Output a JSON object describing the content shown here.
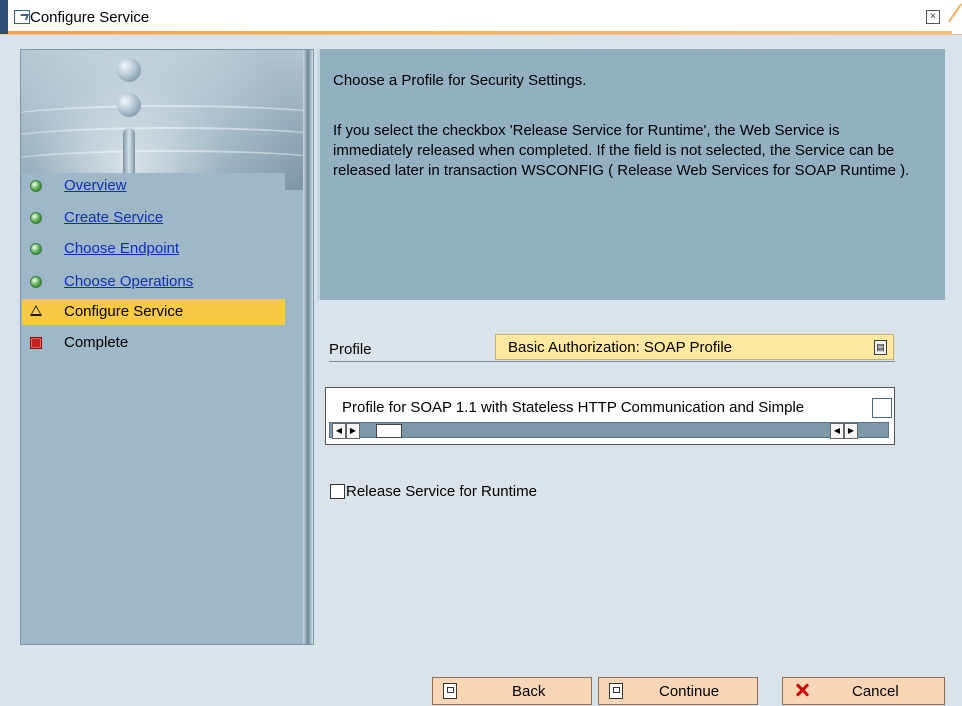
{
  "window": {
    "title": "Configure Service"
  },
  "nav": {
    "items": [
      {
        "label": "Overview"
      },
      {
        "label": "Create Service"
      },
      {
        "label": "Choose Endpoint"
      },
      {
        "label": "Choose Operations"
      },
      {
        "label": "Configure Service"
      },
      {
        "label": "Complete"
      }
    ]
  },
  "info": {
    "heading": "Choose a Profile for Security Settings.",
    "paragraph": "If you select the checkbox 'Release Service for Runtime', the Web Service is immediately released when completed. If the field is not selected, the Service can be released later in transaction WSCONFIG ( Release Web Services for SOAP Runtime )."
  },
  "profile": {
    "label": "Profile",
    "selected": "Basic Authorization: SOAP Profile",
    "description": "Profile for SOAP 1.1 with Stateless HTTP Communication and Simple"
  },
  "release": {
    "label": "Release Service for Runtime"
  },
  "buttons": {
    "back": "Back",
    "continue": "Continue",
    "cancel": "Cancel"
  },
  "colors": {
    "active_item": "#f8c945",
    "link": "#0d2fb6",
    "select_background": "#ffe9a0",
    "button_background": "#f9d7b6"
  }
}
